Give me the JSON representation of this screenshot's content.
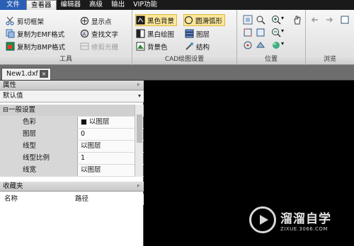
{
  "menubar": {
    "items": [
      "文件",
      "查看器",
      "编辑器",
      "高级",
      "输出",
      "VIP功能"
    ]
  },
  "ribbon": {
    "tools": {
      "caption": "工具",
      "buttons": [
        "剪切框架",
        "复制为EMF格式",
        "复制为BMP格式",
        "显示点",
        "查找文字",
        "修剪光栅"
      ]
    },
    "cad": {
      "caption": "CAD绘图设置",
      "buttons": [
        "黑色背景",
        "黑白绘图",
        "背景色",
        "圆滑弧形",
        "图层",
        "结构"
      ]
    },
    "position": {
      "caption": "位置"
    },
    "browse": {
      "caption": "浏览"
    }
  },
  "tab": {
    "title": "New1.dxf",
    "close": "×"
  },
  "properties": {
    "title": "属性",
    "pin": "ᵖ",
    "dropdown_value": "默认值",
    "category": "⊟一般设置",
    "rows": [
      {
        "key": "色彩",
        "value": "■ 以图层"
      },
      {
        "key": "图层",
        "value": "0"
      },
      {
        "key": "线型",
        "value": "以图层"
      },
      {
        "key": "线型比例",
        "value": "1"
      },
      {
        "key": "线宽",
        "value": "以图层"
      }
    ]
  },
  "favorites": {
    "title": "收藏夹",
    "pin": "ᵖ",
    "col_name": "名称",
    "col_path": "路径"
  },
  "watermark": {
    "brand": "溜溜自学",
    "url": "ZIXUE.3066.COM"
  }
}
